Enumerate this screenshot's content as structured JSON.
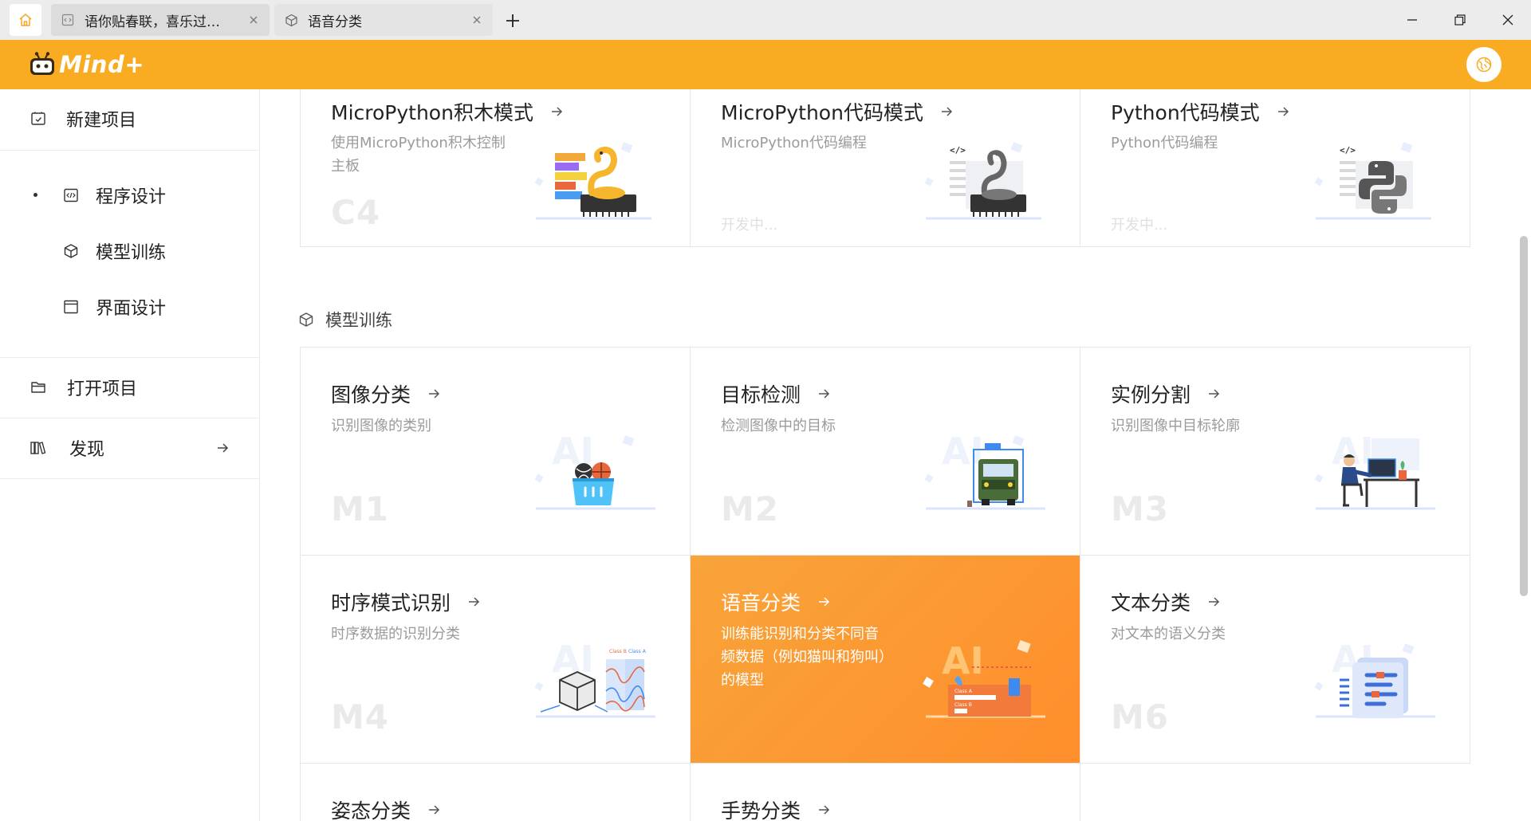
{
  "titlebar": {
    "tabs": [
      {
        "label": "语你贴春联，喜乐过…",
        "icon": "code-file-icon",
        "active": false
      },
      {
        "label": "语音分类",
        "icon": "cube-icon",
        "active": true
      }
    ],
    "new_tab": "+",
    "window_controls": [
      "minimize-icon",
      "restore-icon",
      "close-icon"
    ]
  },
  "header": {
    "logo_text": "Mind+",
    "brand_color": "#f9ac22"
  },
  "sidebar": {
    "items": [
      {
        "label": "新建项目",
        "icon": "new-project-icon"
      },
      {
        "label": "程序设计",
        "icon": "code-icon",
        "active": true
      },
      {
        "label": "模型训练",
        "icon": "cube-icon"
      },
      {
        "label": "界面设计",
        "icon": "window-icon"
      },
      {
        "label": "打开项目",
        "icon": "folder-icon"
      },
      {
        "label": "发现",
        "icon": "books-icon"
      }
    ]
  },
  "programming_cards": [
    {
      "title": "MicroPython积木模式",
      "desc": "使用MicroPython积木控制主板",
      "code": "C4",
      "status": ""
    },
    {
      "title": "MicroPython代码模式",
      "desc": "MicroPython代码编程",
      "code": "",
      "status": "开发中..."
    },
    {
      "title": "Python代码模式",
      "desc": "Python代码编程",
      "code": "",
      "status": "开发中..."
    }
  ],
  "model_section": {
    "title": "模型训练"
  },
  "model_cards": [
    {
      "title": "图像分类",
      "desc": "识别图像的类别",
      "code": "M1"
    },
    {
      "title": "目标检测",
      "desc": "检测图像中的目标",
      "code": "M2"
    },
    {
      "title": "实例分割",
      "desc": "识别图像中目标轮廓",
      "code": "M3"
    },
    {
      "title": "时序模式识别",
      "desc": "时序数据的识别分类",
      "code": "M4"
    },
    {
      "title": "语音分类",
      "desc": "训练能识别和分类不同音频数据（例如猫叫和狗叫）的模型",
      "code": ""
    },
    {
      "title": "文本分类",
      "desc": "对文本的语义分类",
      "code": "M6"
    },
    {
      "title": "姿态分类",
      "desc": "",
      "code": ""
    },
    {
      "title": "手势分类",
      "desc": "",
      "code": ""
    }
  ],
  "art_labels": {
    "ai": "AI",
    "code_tag": "</>",
    "class_a": "Class A",
    "class_b": "Class B"
  }
}
